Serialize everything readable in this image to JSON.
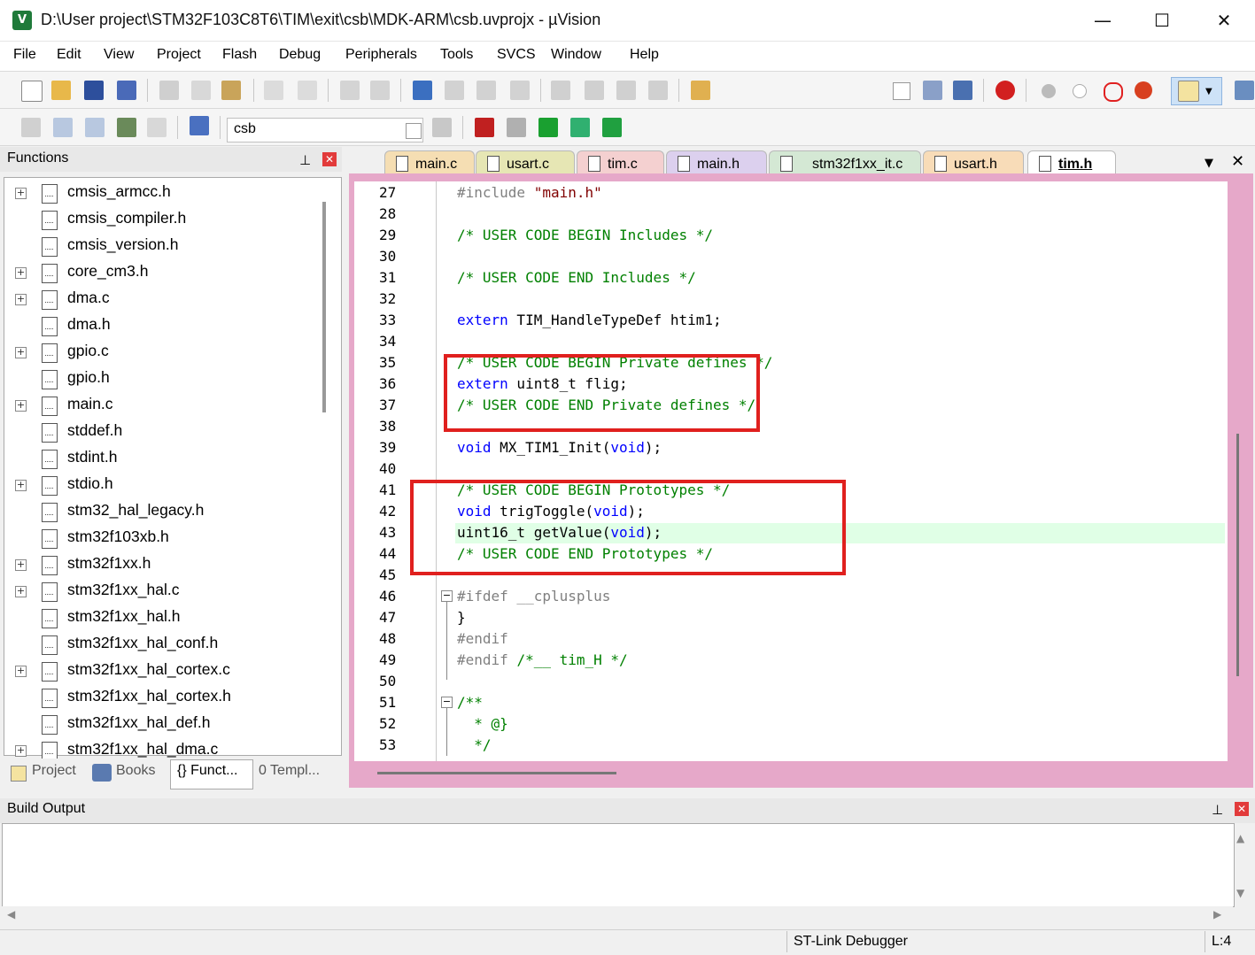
{
  "window": {
    "title": "D:\\User project\\STM32F103C8T6\\TIM\\exit\\csb\\MDK-ARM\\csb.uvprojx - µVision",
    "minimize": "—",
    "maximize": "☐",
    "close": "✕"
  },
  "menu": [
    "File",
    "Edit",
    "View",
    "Project",
    "Flash",
    "Debug",
    "Peripherals",
    "Tools",
    "SVCS",
    "Window",
    "Help"
  ],
  "toolbar2": {
    "target": "csb"
  },
  "functions_panel": {
    "title": "Functions",
    "pin": "🖈",
    "close": "✕",
    "items": [
      {
        "name": "cmsis_armcc.h",
        "expandable": true
      },
      {
        "name": "cmsis_compiler.h",
        "expandable": false
      },
      {
        "name": "cmsis_version.h",
        "expandable": false
      },
      {
        "name": "core_cm3.h",
        "expandable": true
      },
      {
        "name": "dma.c",
        "expandable": true
      },
      {
        "name": "dma.h",
        "expandable": false
      },
      {
        "name": "gpio.c",
        "expandable": true
      },
      {
        "name": "gpio.h",
        "expandable": false
      },
      {
        "name": "main.c",
        "expandable": true
      },
      {
        "name": "stddef.h",
        "expandable": false
      },
      {
        "name": "stdint.h",
        "expandable": false
      },
      {
        "name": "stdio.h",
        "expandable": true
      },
      {
        "name": "stm32_hal_legacy.h",
        "expandable": false
      },
      {
        "name": "stm32f103xb.h",
        "expandable": false
      },
      {
        "name": "stm32f1xx.h",
        "expandable": true
      },
      {
        "name": "stm32f1xx_hal.c",
        "expandable": true
      },
      {
        "name": "stm32f1xx_hal.h",
        "expandable": false
      },
      {
        "name": "stm32f1xx_hal_conf.h",
        "expandable": false
      },
      {
        "name": "stm32f1xx_hal_cortex.c",
        "expandable": true
      },
      {
        "name": "stm32f1xx_hal_cortex.h",
        "expandable": false
      },
      {
        "name": "stm32f1xx_hal_def.h",
        "expandable": false
      },
      {
        "name": "stm32f1xx_hal_dma.c",
        "expandable": true
      }
    ],
    "tabs": [
      "Project",
      "Books",
      "{} Funct...",
      "0 Templ..."
    ]
  },
  "editor": {
    "tabs": [
      {
        "label": "main.c",
        "color": "#f5deb3"
      },
      {
        "label": "usart.c",
        "color": "#e6e6b4"
      },
      {
        "label": "tim.c",
        "color": "#f4d0d0"
      },
      {
        "label": "main.h",
        "color": "#dcd0ee"
      },
      {
        "label": "stm32f1xx_it.c",
        "color": "#d4e8d4"
      },
      {
        "label": "usart.h",
        "color": "#f8dcb8"
      },
      {
        "label": "tim.h",
        "color": "#ffffff"
      }
    ],
    "active_tab": "tim.h",
    "lines": [
      {
        "n": "27",
        "t": "#include \"main.h\""
      },
      {
        "n": "28",
        "t": ""
      },
      {
        "n": "29",
        "t": "/* USER CODE BEGIN Includes */"
      },
      {
        "n": "30",
        "t": ""
      },
      {
        "n": "31",
        "t": "/* USER CODE END Includes */"
      },
      {
        "n": "32",
        "t": ""
      },
      {
        "n": "33",
        "t": "extern TIM_HandleTypeDef htim1;"
      },
      {
        "n": "34",
        "t": ""
      },
      {
        "n": "35",
        "t": "/* USER CODE BEGIN Private defines */"
      },
      {
        "n": "36",
        "t": "extern uint8_t flig;"
      },
      {
        "n": "37",
        "t": "/* USER CODE END Private defines */"
      },
      {
        "n": "38",
        "t": ""
      },
      {
        "n": "39",
        "t": "void MX_TIM1_Init(void);"
      },
      {
        "n": "40",
        "t": ""
      },
      {
        "n": "41",
        "t": "/* USER CODE BEGIN Prototypes */"
      },
      {
        "n": "42",
        "t": "void trigToggle(void);"
      },
      {
        "n": "43",
        "t": "uint16_t getValue(void);"
      },
      {
        "n": "44",
        "t": "/* USER CODE END Prototypes */"
      },
      {
        "n": "45",
        "t": ""
      },
      {
        "n": "46",
        "t": "#ifdef __cplusplus"
      },
      {
        "n": "47",
        "t": "}"
      },
      {
        "n": "48",
        "t": "#endif"
      },
      {
        "n": "49",
        "t": "#endif /*__ tim_H */"
      },
      {
        "n": "50",
        "t": ""
      },
      {
        "n": "51",
        "t": "/**"
      },
      {
        "n": "52",
        "t": "  * @}"
      },
      {
        "n": "53",
        "t": "  */"
      }
    ]
  },
  "build_output": {
    "title": "Build Output"
  },
  "status": {
    "debugger": "ST-Link Debugger",
    "line": "L:4"
  },
  "colors": {
    "keyword": "#0000ff",
    "comment": "#008000",
    "string": "#800000",
    "annotation_box": "#e0201e",
    "highlight_line": "#e0ffe6",
    "editor_frame": "#e6a8c9"
  }
}
